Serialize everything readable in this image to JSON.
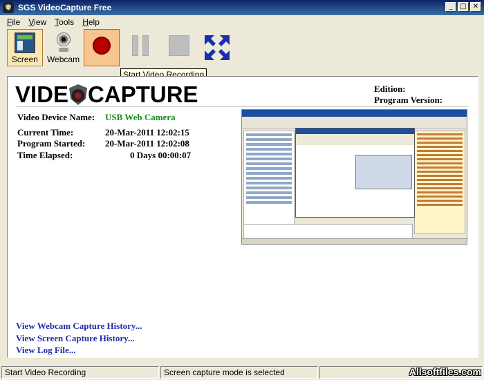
{
  "window": {
    "title": "SGS VideoCapture Free"
  },
  "window_buttons": {
    "minimize": "_",
    "maximize": "□",
    "close": "✕"
  },
  "menu": {
    "items": [
      {
        "label": "File",
        "accel": "F",
        "rest": "ile"
      },
      {
        "label": "View",
        "accel": "V",
        "rest": "iew"
      },
      {
        "label": "Tools",
        "accel": "T",
        "rest": "ools"
      },
      {
        "label": "Help",
        "accel": "H",
        "rest": "elp"
      }
    ]
  },
  "toolbar": {
    "screen_label": "Screen",
    "webcam_label": "Webcam",
    "tooltip": "Start Video Recording"
  },
  "logo": {
    "left": "VIDE",
    "right": "CAPTURE"
  },
  "edition": {
    "edition_label": "Edition:",
    "version_label": "Program Version:"
  },
  "info": {
    "device_label": "Video Device Name:",
    "device_value": "USB Web Camera",
    "current_label": "Current  Time:",
    "current_value": "20-Mar-2011  12:02:15",
    "started_label": "Program Started:",
    "started_value": "20-Mar-2011  12:02:08",
    "elapsed_label": "Time  Elapsed:",
    "elapsed_value": "0 Days  00:00:07"
  },
  "links": {
    "webcam_history": "View Webcam Capture History...",
    "screen_history": "View Screen Capture History...",
    "log_file": "View Log File..."
  },
  "status": {
    "left": "Start Video Recording",
    "mid": "Screen capture mode is selected",
    "right": ""
  },
  "watermark": "Allsoftfiles.com"
}
